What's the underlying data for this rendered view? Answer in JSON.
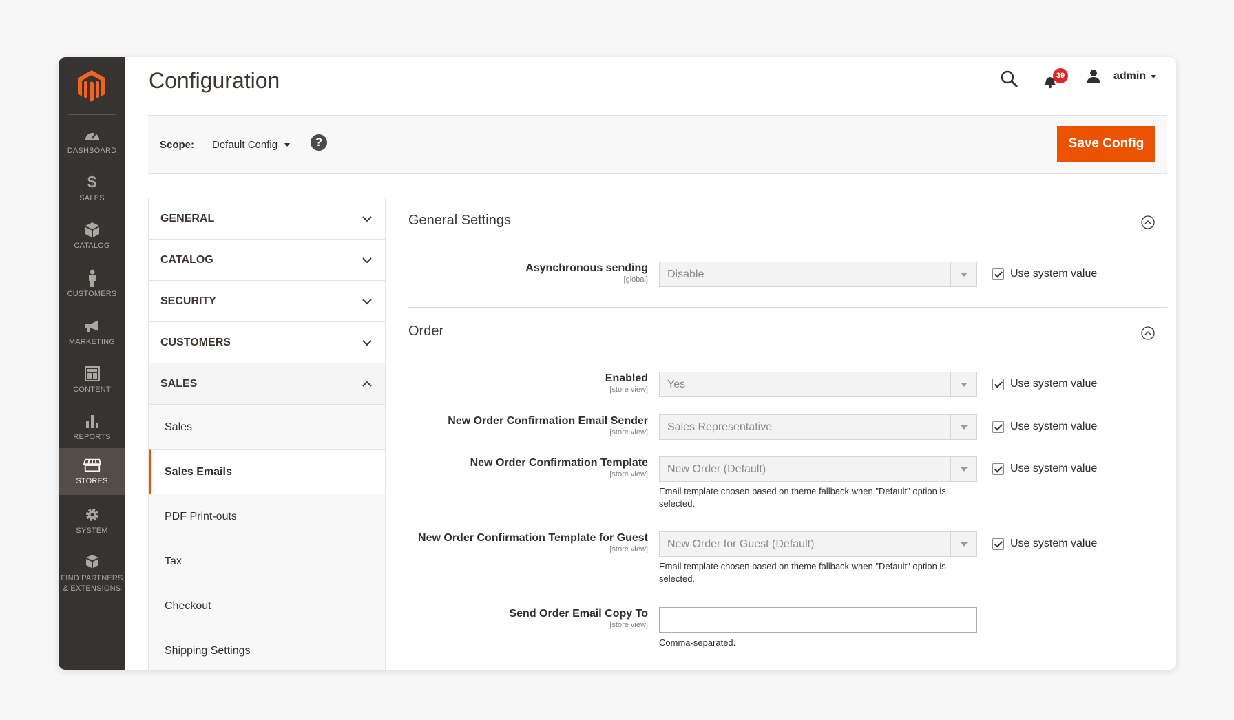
{
  "nav": {
    "items": [
      {
        "label": "DASHBOARD",
        "icon": "dashboard-icon"
      },
      {
        "label": "SALES",
        "icon": "dollar-icon"
      },
      {
        "label": "CATALOG",
        "icon": "box-icon"
      },
      {
        "label": "CUSTOMERS",
        "icon": "person-icon"
      },
      {
        "label": "MARKETING",
        "icon": "megaphone-icon"
      },
      {
        "label": "CONTENT",
        "icon": "layout-icon"
      },
      {
        "label": "REPORTS",
        "icon": "bar-chart-icon"
      },
      {
        "label": "STORES",
        "icon": "store-icon"
      },
      {
        "label": "SYSTEM",
        "icon": "gear-icon"
      },
      {
        "label": "FIND PARTNERS & EXTENSIONS",
        "icon": "cubes-icon"
      }
    ],
    "active": "STORES"
  },
  "header": {
    "title": "Configuration",
    "notifications_count": "39",
    "user": "admin"
  },
  "scope": {
    "label": "Scope:",
    "value": "Default Config",
    "help": "?",
    "save_label": "Save Config"
  },
  "tabs": {
    "groups": [
      "GENERAL",
      "CATALOG",
      "SECURITY",
      "CUSTOMERS",
      "SALES"
    ],
    "sales_items": [
      "Sales",
      "Sales Emails",
      "PDF Print-outs",
      "Tax",
      "Checkout",
      "Shipping Settings"
    ],
    "active_item": "Sales Emails"
  },
  "general_settings": {
    "title": "General Settings",
    "async": {
      "label": "Asynchronous sending",
      "scope": "[global]",
      "value": "Disable",
      "use_system": "Use system value"
    }
  },
  "order": {
    "title": "Order",
    "enabled": {
      "label": "Enabled",
      "scope": "[store view]",
      "value": "Yes",
      "use_system": "Use system value"
    },
    "sender": {
      "label": "New Order Confirmation Email Sender",
      "scope": "[store view]",
      "value": "Sales Representative",
      "use_system": "Use system value"
    },
    "template": {
      "label": "New Order Confirmation Template",
      "scope": "[store view]",
      "value": "New Order (Default)",
      "use_system": "Use system value",
      "note": "Email template chosen based on theme fallback when \"Default\" option is selected."
    },
    "guest_template": {
      "label": "New Order Confirmation Template for Guest",
      "scope": "[store view]",
      "value": "New Order for Guest (Default)",
      "use_system": "Use system value",
      "note": "Email template chosen based on theme fallback when \"Default\" option is selected."
    },
    "copy_to": {
      "label": "Send Order Email Copy To",
      "scope": "[store view]",
      "value": "",
      "note": "Comma-separated."
    }
  },
  "colors": {
    "accent": "#eb5202",
    "nav_bg": "#373330",
    "badge": "#e22626"
  }
}
